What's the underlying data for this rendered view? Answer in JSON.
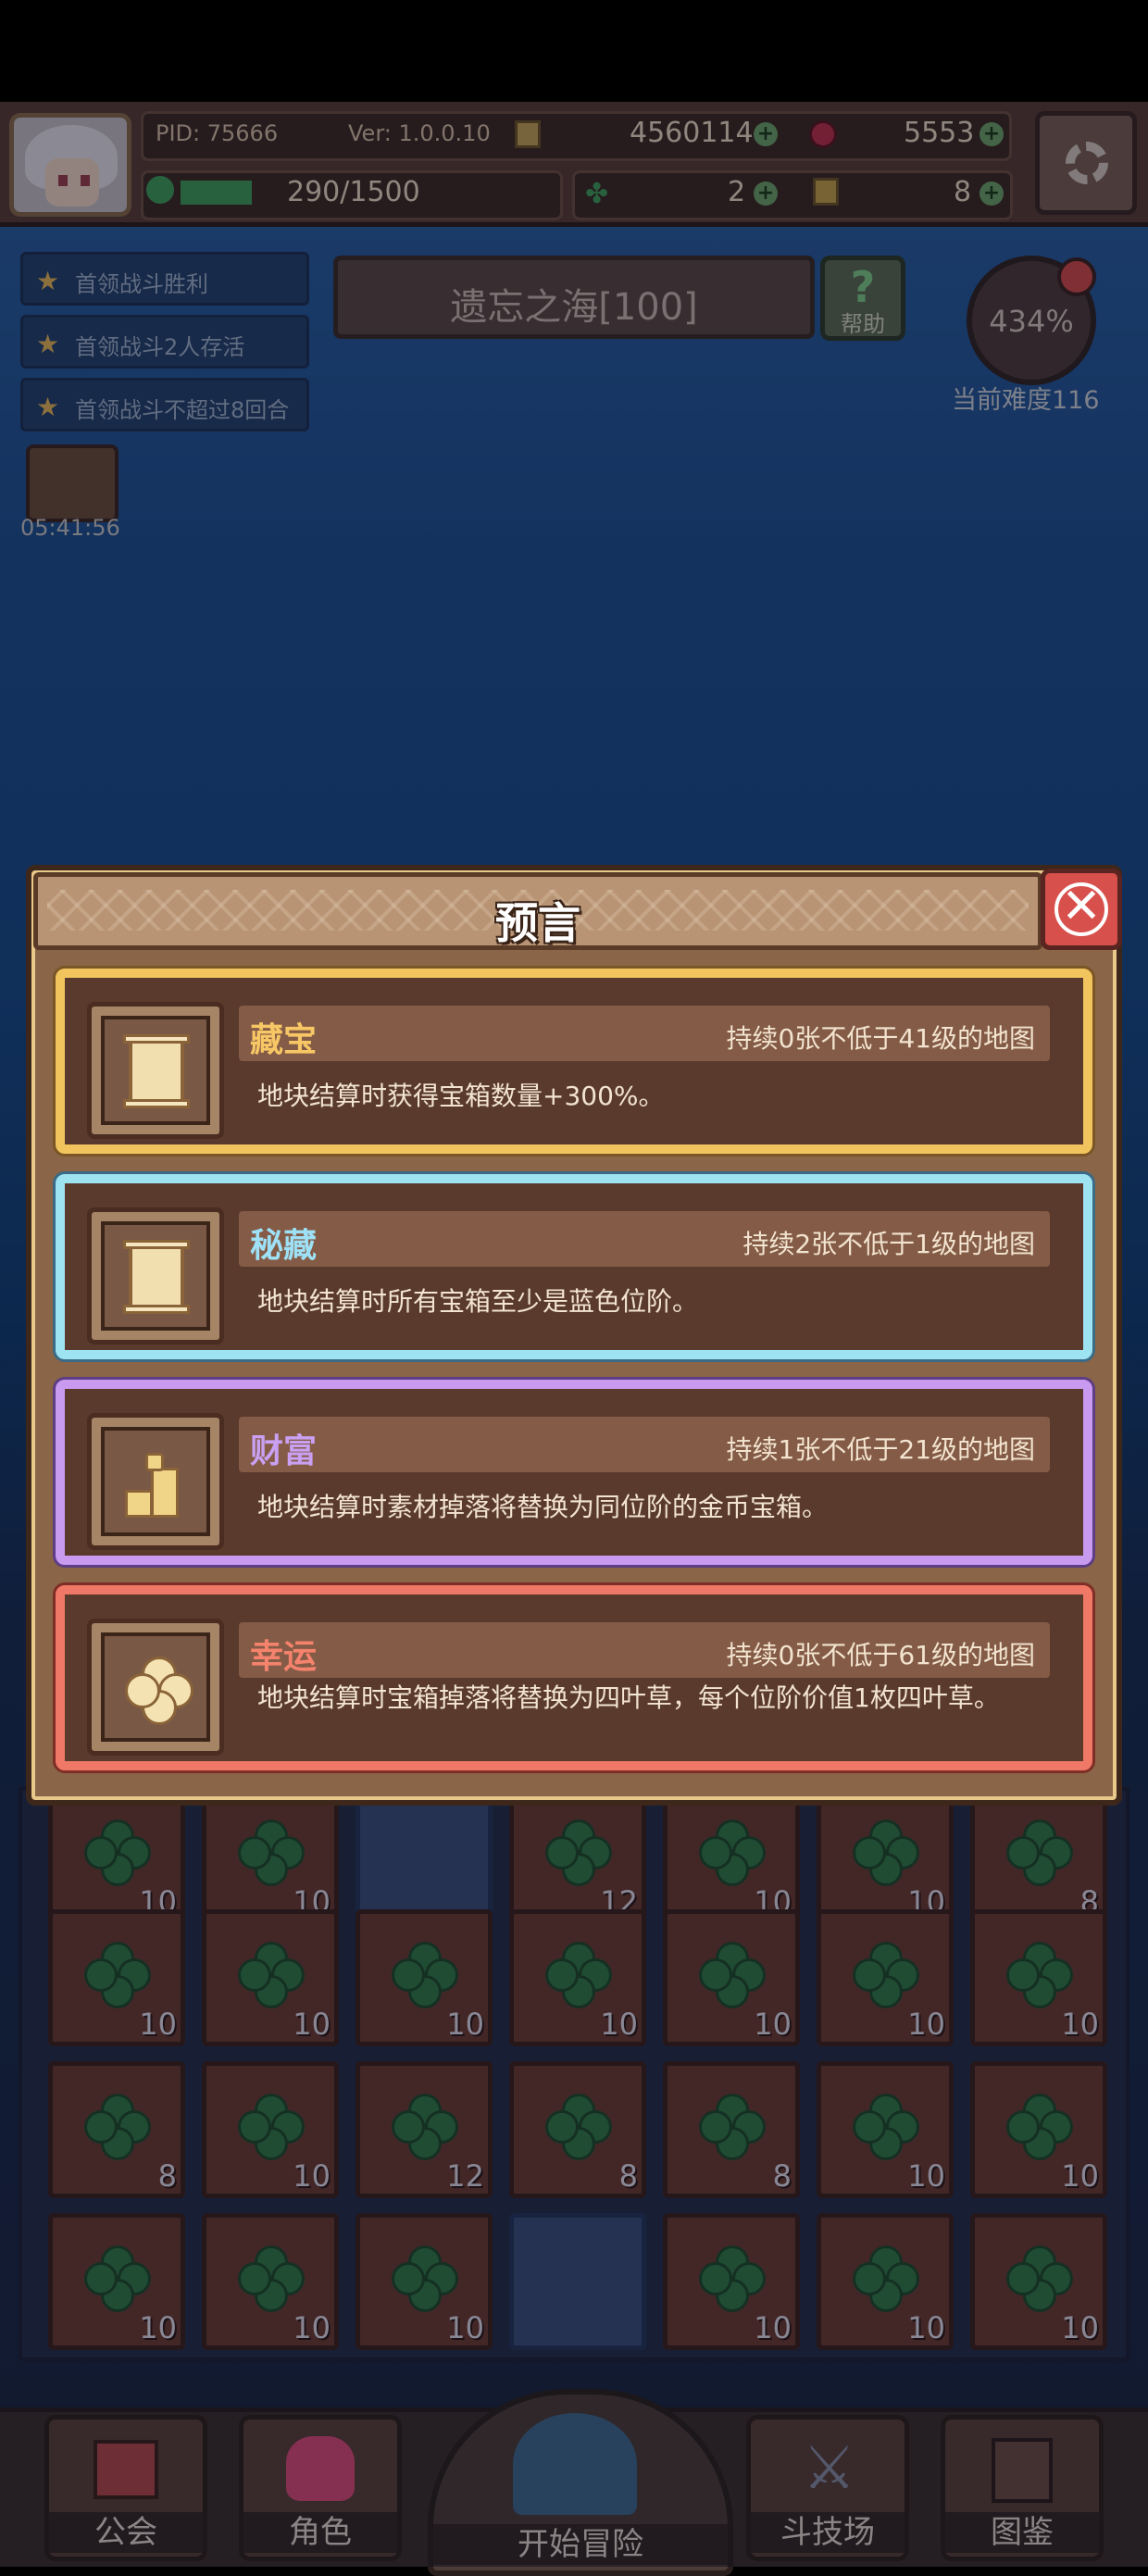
{
  "header": {
    "pid": "PID: 75666",
    "version": "Ver: 1.0.0.10",
    "gold": "4560114",
    "gems": "5553",
    "energy": "290/1500",
    "energy_fraction": 0.193,
    "clovers": "2",
    "keys": "8"
  },
  "quests": [
    "首领战斗胜利",
    "首领战斗2人存活",
    "首领战斗不超过8回合"
  ],
  "reward_timer": "05:41:56",
  "map": {
    "title": "遗忘之海[100]",
    "help": "帮助"
  },
  "difficulty": {
    "percent": "434%",
    "label": "当前难度116"
  },
  "dialog": {
    "title": "预言",
    "close_symbol": "✕",
    "cards": [
      {
        "name": "藏宝",
        "condition": "持续0张不低于41级的地图",
        "description": "地块结算时获得宝箱数量+300%。",
        "theme": "gold",
        "name_color": "#f7c765",
        "icon": "scroll-icon"
      },
      {
        "name": "秘藏",
        "condition": "持续2张不低于1级的地图",
        "description": "地块结算时所有宝箱至少是蓝色位阶。",
        "theme": "blue",
        "name_color": "#9ee0f5",
        "icon": "scroll-icon"
      },
      {
        "name": "财富",
        "condition": "持续1张不低于21级的地图",
        "description": "地块结算时素材掉落将替换为同位阶的金币宝箱。",
        "theme": "purple",
        "name_color": "#c9a0f2",
        "icon": "coin-stack-icon"
      },
      {
        "name": "幸运",
        "condition": "持续0张不低于61级的地图",
        "description": "地块结算时宝箱掉落将替换为四叶草，每个位阶价值1枚四叶草。",
        "theme": "red",
        "name_color": "#f5826c",
        "icon": "four-leaf-clover-icon"
      }
    ]
  },
  "grid_counts": [
    [
      "10",
      "10",
      "",
      "12",
      "10",
      "10",
      "8"
    ],
    [
      "10",
      "10",
      "10",
      "10",
      "10",
      "10",
      "10"
    ],
    [
      "8",
      "10",
      "12",
      "8",
      "8",
      "10",
      "10"
    ],
    [
      "10",
      "10",
      "10",
      "",
      "10",
      "10",
      "10"
    ]
  ],
  "nav": {
    "guild": "公会",
    "character": "角色",
    "start": "开始冒险",
    "arena": "斗技场",
    "codex": "图鉴"
  },
  "colors": {
    "accent_gold": "#f2c45e",
    "dialog_bg": "#8a6547",
    "close_red": "#d8504c"
  }
}
